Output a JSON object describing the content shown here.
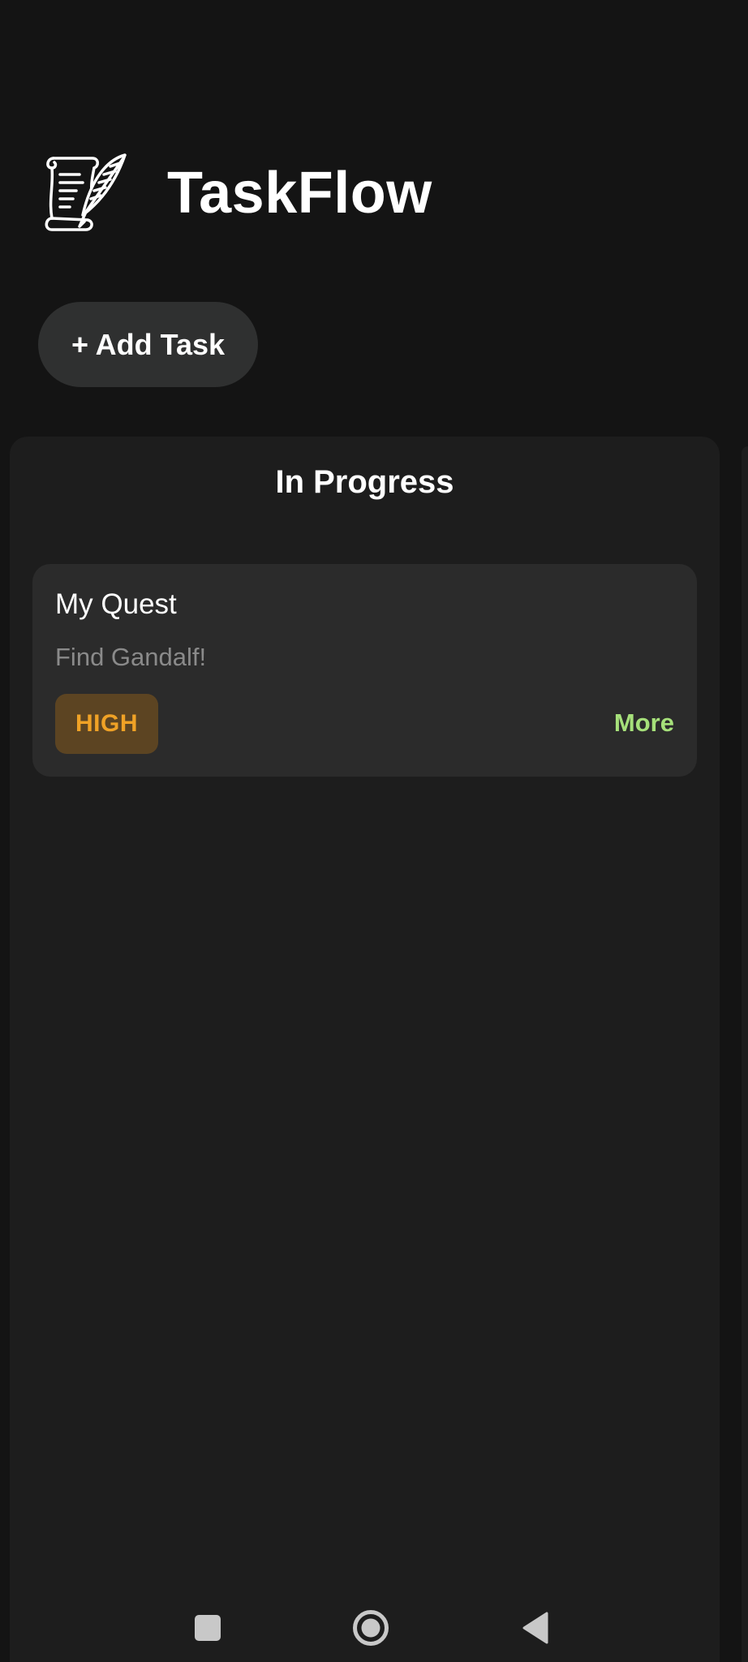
{
  "app": {
    "title": "TaskFlow",
    "logo_icon": "scroll-quill-icon"
  },
  "toolbar": {
    "add_task_label": "+ Add Task"
  },
  "column": {
    "title": "In Progress",
    "tasks": [
      {
        "title": "My Quest",
        "description": "Find Gandalf!",
        "priority": "HIGH",
        "more_label": "More"
      }
    ]
  },
  "nav": {
    "recents_icon": "square-icon",
    "home_icon": "circle-icon",
    "back_icon": "triangle-back-icon"
  },
  "colors": {
    "background": "#141414",
    "column_bg": "#1d1d1d",
    "card_bg": "#2b2b2b",
    "priority_high_text": "#f0a226",
    "priority_high_bg": "#5c4422",
    "more_link": "#a6e07a"
  }
}
